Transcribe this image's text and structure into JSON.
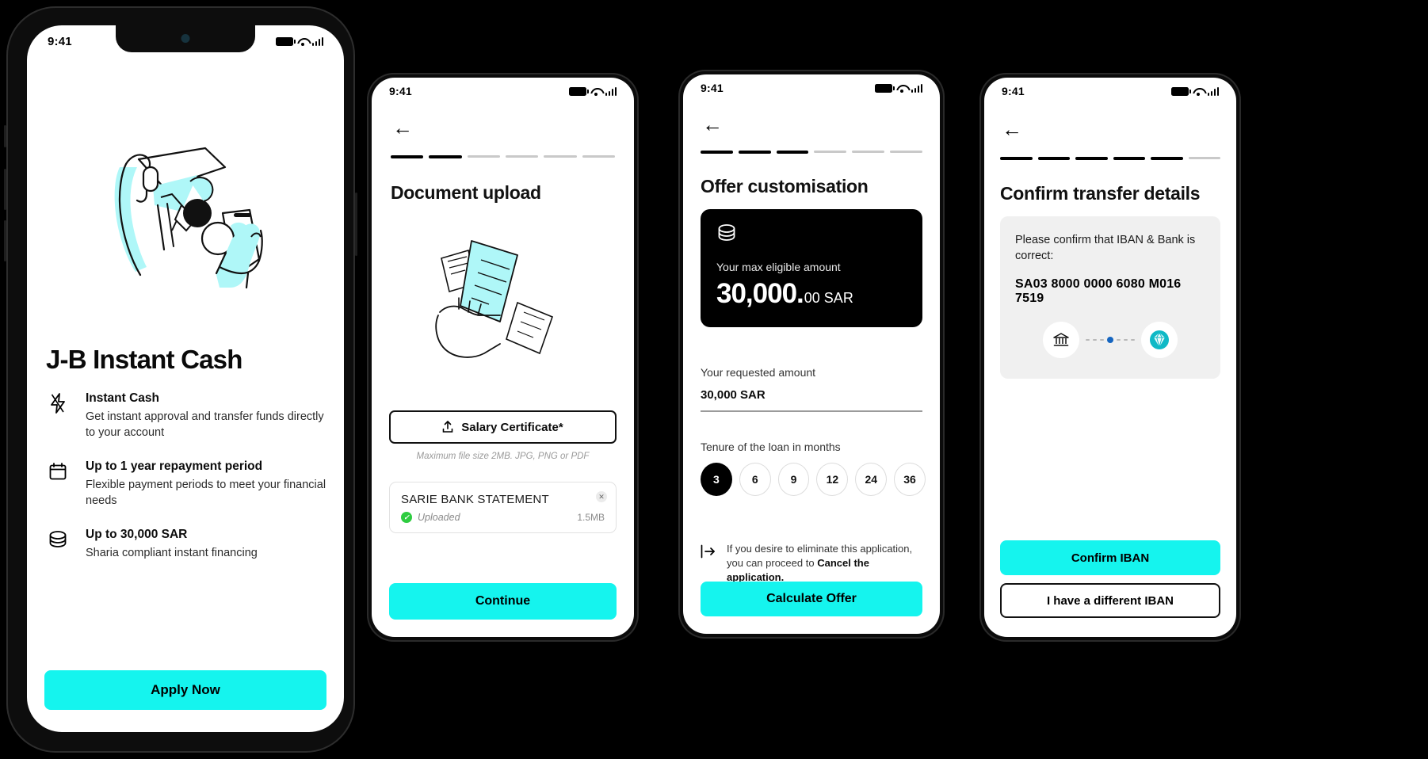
{
  "theme": {
    "accent": "#15F4EE",
    "dark": "#000000",
    "muted": "#8a8a8a",
    "card_gray": "#f0f0f0",
    "success": "#2ecc40"
  },
  "status_bar": {
    "time": "9:41"
  },
  "phone1": {
    "title": "J-B Instant Cash",
    "features": [
      {
        "icon": "lightning-icon",
        "heading": "Instant Cash",
        "body": "Get instant approval and transfer funds directly to your account"
      },
      {
        "icon": "calendar-icon",
        "heading": "Up to 1 year repayment period",
        "body": "Flexible payment periods to meet your financial needs"
      },
      {
        "icon": "coins-icon",
        "heading": "Up to 30,000 SAR",
        "body": "Sharia compliant instant financing"
      }
    ],
    "cta": "Apply Now"
  },
  "phone2": {
    "back": "back-arrow",
    "progress": {
      "total": 6,
      "completed": 2
    },
    "title": "Document upload",
    "upload_button": "Salary Certificate*",
    "upload_icon": "upload-icon",
    "note": "Maximum file size 2MB. JPG, PNG or PDF",
    "file": {
      "name": "SARIE BANK STATEMENT",
      "status": "Uploaded",
      "size": "1.5MB",
      "remove_icon": "close-icon"
    },
    "cta": "Continue"
  },
  "phone3": {
    "progress": {
      "total": 6,
      "completed": 3
    },
    "title": "Offer customisation",
    "card": {
      "icon": "coins-icon",
      "label": "Your max eligible amount",
      "amount_major": "30,000.",
      "amount_minor": "00 SAR"
    },
    "requested_label": "Your requested amount",
    "requested_value": "30,000 SAR",
    "tenure_label": "Tenure of the loan in months",
    "tenure_options": [
      "3",
      "6",
      "9",
      "12",
      "24",
      "36"
    ],
    "tenure_selected": "3",
    "cancel_icon": "logout-icon",
    "cancel_text_1": "If you desire to eliminate this application, you can proceed to ",
    "cancel_text_bold": "Cancel the application.",
    "cta": "Calculate Offer"
  },
  "phone4": {
    "progress": {
      "total": 6,
      "completed": 5
    },
    "title": "Confirm transfer details",
    "note": "Please confirm that IBAN & Bank is correct:",
    "iban": "SA03 8000 0000 6080 M016 7519",
    "flow": {
      "from_icon": "bank-icon",
      "to_icon": "gem-icon"
    },
    "cta_primary": "Confirm IBAN",
    "cta_secondary": "I have a different IBAN"
  }
}
